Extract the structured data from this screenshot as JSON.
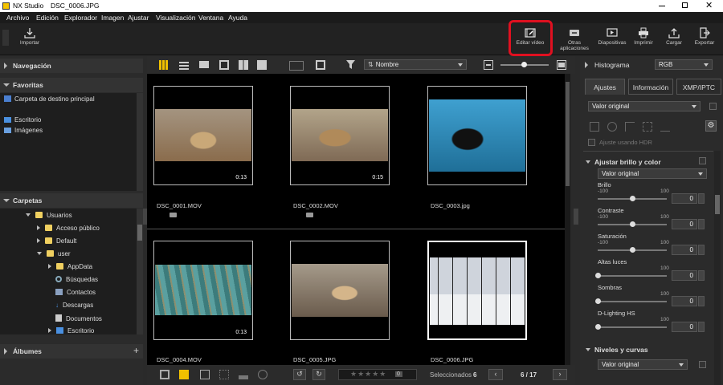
{
  "window": {
    "app": "NX Studio",
    "file": "DSC_0006.JPG"
  },
  "menu": [
    "Archivo",
    "Edición",
    "Explorador",
    "Imagen",
    "Ajustar",
    "Visualización",
    "Ventana",
    "Ayuda"
  ],
  "toolbar": {
    "import": "Importar",
    "edit_video": "Editar vídeo",
    "other_apps": "Otras aplicaciones",
    "slideshow": "Diapositivas",
    "print": "Imprimir",
    "upload": "Cargar",
    "export": "Exportar"
  },
  "left": {
    "navigation": "Navegación",
    "favorites": "Favoritas",
    "favorites_items": [
      "Carpeta de destino principal",
      "Escritorio",
      "Imágenes"
    ],
    "folders": "Carpetas",
    "folder_tree": [
      "Usuarios",
      "Acceso público",
      "Default",
      "user",
      "AppData",
      "Búsquedas",
      "Contactos",
      "Descargas",
      "Documentos",
      "Escritorio"
    ],
    "albums": "Álbumes"
  },
  "grid_toolbar": {
    "sort": "Nombre"
  },
  "thumbnails": [
    {
      "name": "DSC_0001.MOV",
      "duration": "0:13",
      "video": true
    },
    {
      "name": "DSC_0002.MOV",
      "duration": "0:15",
      "video": true
    },
    {
      "name": "DSC_0003.jpg",
      "duration": "",
      "video": false
    },
    {
      "name": "DSC_0004.MOV",
      "duration": "0:13",
      "video": true
    },
    {
      "name": "DSC_0005.JPG",
      "duration": "",
      "video": false
    },
    {
      "name": "DSC_0006.JPG",
      "duration": "",
      "video": false,
      "selected": true
    }
  ],
  "status": {
    "selected_label": "Seleccionados",
    "selected_count": "6",
    "page": "6 / 17",
    "rating_zero": "0"
  },
  "right": {
    "histogram": "Histograma",
    "histogram_mode": "RGB",
    "tabs": [
      "Ajustes",
      "Información",
      "XMP/IPTC"
    ],
    "preset": "Valor original",
    "hdr": "Ajuste usando HDR",
    "brightness_section": "Ajustar brillo y color",
    "brightness_preset": "Valor original",
    "sliders": [
      {
        "label": "Brillo",
        "min": "-100",
        "max": "100",
        "value": "0"
      },
      {
        "label": "Contraste",
        "min": "-100",
        "max": "100",
        "value": "0"
      },
      {
        "label": "Saturación",
        "min": "-100",
        "max": "100",
        "value": "0"
      },
      {
        "label": "Altas luces",
        "min": "",
        "max": "100",
        "value": "0"
      },
      {
        "label": "Sombras",
        "min": "",
        "max": "100",
        "value": "0"
      },
      {
        "label": "D-Lighting HS",
        "min": "",
        "max": "100",
        "value": "0"
      }
    ],
    "levels_section": "Niveles y curvas",
    "levels_preset": "Valor original"
  },
  "colors": {
    "highlight": "#e01020",
    "selection": "#ffffff"
  }
}
